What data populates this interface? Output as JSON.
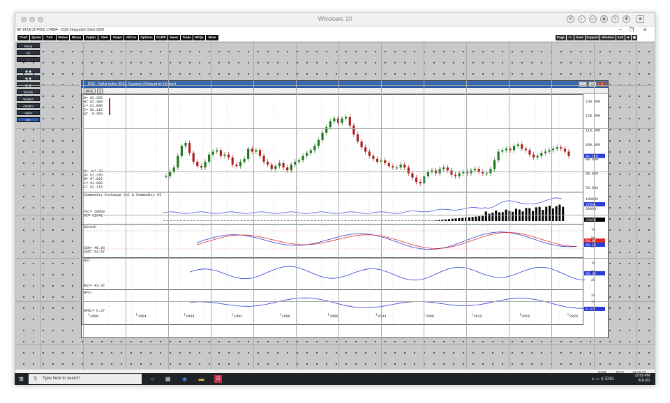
{
  "window": {
    "mac_title": "Windows 10",
    "app_title": "NF 14:09:25   P002   174854 - CQG Integrated Client 2020",
    "controls": [
      "–",
      "❐",
      "✕"
    ]
  },
  "menu": {
    "left": [
      "Chart",
      "Quote",
      "T&S",
      "Status",
      "Mtcao",
      "Suptsr",
      "Alert",
      "Snapt",
      "AllCon",
      "Options",
      "Ordt/tr",
      "News",
      "Trade",
      "RFQs",
      "More"
    ],
    "right": [
      "Page",
      "<>",
      "Save",
      "Support",
      "Window",
      "Exit",
      "◙",
      "▣"
    ]
  },
  "left_panel": [
    "Setup",
    "1U",
    "⊘",
    "◉ ◉",
    "◉ ◉",
    "◉ ◉",
    "Refrsh",
    "Studies",
    "<Setttr>",
    "<Nkt>",
    "DX"
  ],
  "chart_window": {
    "title": "DXE - Dollar Index (ICE), Quarterly (Delayed by 10 mins)",
    "toolbar": [
      "DX.IL",
      "✕"
    ],
    "header_readout": [
      "O= 82.285",
      "H= 82.480",
      "L= 81.880",
      "C= 82.115",
      "Δ= -0.264"
    ],
    "cursor_readout": [
      "01 Jul 20",
      "O= 97.370",
      "H= 97.615",
      "L= 91.990",
      "C= 92.110"
    ],
    "last_price": "92.110",
    "price_ticks": [
      "130.000",
      "120.000",
      "110.000",
      "100.000",
      "90.000",
      "80.000",
      "70.000"
    ],
    "panels": {
      "volume": {
        "label": "Commodity Exchange Vol & Commodity OI",
        "readout": [
          "Vol= 28050",
          "OI= 31041"
        ],
        "ticks": [
          "100000",
          "50000"
        ],
        "last": "37041",
        "last2": "28050"
      },
      "stoch": {
        "label": "SStoch",
        "readout": [
          "SSK= 48.18",
          "SSD= 54.87"
        ],
        "ticks": [
          "75",
          "50",
          "25"
        ],
        "last": "54.87",
        "last2": "48.18"
      },
      "rsi": {
        "label": "RSI",
        "readout": [
          "RSI= 43.32"
        ],
        "ticks": [
          "75",
          "50",
          "25"
        ],
        "last": "43.32"
      },
      "vol": {
        "label": "HVol",
        "readout": [
          "HVOL= 6.27"
        ],
        "ticks": [
          "15",
          "10",
          "5"
        ],
        "last": "6.27"
      }
    },
    "x_axis": [
      "1980",
      "1984",
      "1988",
      "1992",
      "1996",
      "2000",
      "2004",
      "2008",
      "2012",
      "2016",
      "2020"
    ],
    "colors": {
      "up": "#1f7a1f",
      "down": "#b01f1f",
      "line_blue": "#2a3bd6",
      "line_red": "#e02a2a",
      "tag_blue": "#2a3bd6"
    }
  },
  "status_bar": {
    "left": "",
    "right": [
      "NUM",
      "P002",
      "14:09:25"
    ]
  },
  "taskbar": {
    "search_placeholder": "Type here to search",
    "time": "12:09 PM",
    "date": "8/11/20",
    "tray": "∧ ▭ ⊄ ENG"
  }
}
